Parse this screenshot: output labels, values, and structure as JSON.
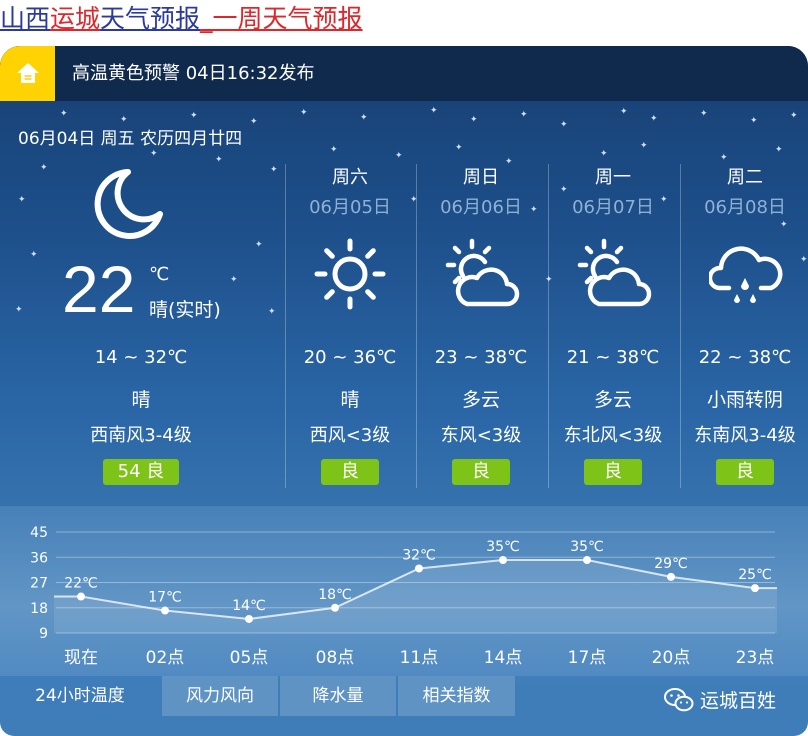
{
  "page_title": {
    "prefix": "山西",
    "city": "运城",
    "middle": "天气预报",
    "week_link": "_一周天气预报"
  },
  "alert": {
    "text": "高温黄色预警 04日16:32发布",
    "icon": "home-icon"
  },
  "today": {
    "date_line": "06月04日 周五 农历四月廿四",
    "icon": "moon-icon",
    "temp": "22",
    "unit": "℃",
    "condition_live": "晴(实时)",
    "range": "14 ~ 32℃",
    "weather": "晴",
    "wind": "西南风3-4级",
    "aqi": "54 良"
  },
  "forecast": [
    {
      "week": "周六",
      "date": "06月05日",
      "icon": "sun-icon",
      "range": "20 ~ 36℃",
      "weather": "晴",
      "wind": "西风<3级",
      "aqi": "良"
    },
    {
      "week": "周日",
      "date": "06月06日",
      "icon": "partly-cloudy-icon",
      "range": "23 ~ 38℃",
      "weather": "多云",
      "wind": "东风<3级",
      "aqi": "良"
    },
    {
      "week": "周一",
      "date": "06月07日",
      "icon": "partly-cloudy-icon",
      "range": "21 ~ 38℃",
      "weather": "多云",
      "wind": "东北风<3级",
      "aqi": "良"
    },
    {
      "week": "周二",
      "date": "06月08日",
      "icon": "rain-cloud-icon",
      "range": "22 ~ 38℃",
      "weather": "小雨转阴",
      "wind": "东南风3-4级",
      "aqi": "良"
    }
  ],
  "colors": {
    "alert_icon_bg": "#ffd203",
    "aqi_good": "#7ec317",
    "title_blue": "#2b3a9c",
    "title_red": "#e0262a"
  },
  "chart_data": {
    "type": "line",
    "categories": [
      "现在",
      "02点",
      "05点",
      "08点",
      "11点",
      "14点",
      "17点",
      "20点",
      "23点"
    ],
    "series": [
      {
        "values": [
          22,
          17,
          14,
          18,
          32,
          35,
          35,
          29,
          25
        ]
      }
    ],
    "point_labels": [
      "22℃",
      "17℃",
      "14℃",
      "18℃",
      "32℃",
      "35℃",
      "35℃",
      "29℃",
      "25℃"
    ],
    "y_ticks": [
      45,
      36,
      27,
      18,
      9
    ],
    "ylim": [
      9,
      45
    ],
    "grid": true,
    "area_fill": true
  },
  "tabs": [
    {
      "label": "24小时温度",
      "active": true
    },
    {
      "label": "风力风向",
      "active": false
    },
    {
      "label": "降水量",
      "active": false
    },
    {
      "label": "相关指数",
      "active": false
    }
  ],
  "brand": {
    "icon": "wechat-icon",
    "text": "运城百姓"
  }
}
